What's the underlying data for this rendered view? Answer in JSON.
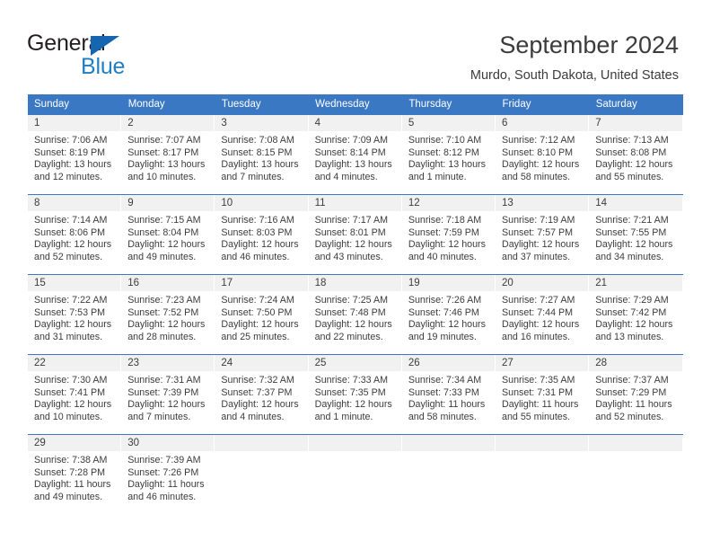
{
  "brand": {
    "name_primary": "General",
    "name_secondary": "Blue",
    "triangle_color": "#1565b0",
    "secondary_color": "#1f7ec4"
  },
  "header": {
    "title": "September 2024",
    "subtitle": "Murdo, South Dakota, United States",
    "accent_color": "#3b78c3",
    "band_color": "#f1f1f1"
  },
  "calendar": {
    "weekday_headers": [
      "Sunday",
      "Monday",
      "Tuesday",
      "Wednesday",
      "Thursday",
      "Friday",
      "Saturday"
    ],
    "weeks": [
      [
        {
          "day": "1",
          "sunrise": "Sunrise: 7:06 AM",
          "sunset": "Sunset: 8:19 PM",
          "daylight_line1": "Daylight: 13 hours",
          "daylight_line2": "and 12 minutes."
        },
        {
          "day": "2",
          "sunrise": "Sunrise: 7:07 AM",
          "sunset": "Sunset: 8:17 PM",
          "daylight_line1": "Daylight: 13 hours",
          "daylight_line2": "and 10 minutes."
        },
        {
          "day": "3",
          "sunrise": "Sunrise: 7:08 AM",
          "sunset": "Sunset: 8:15 PM",
          "daylight_line1": "Daylight: 13 hours",
          "daylight_line2": "and 7 minutes."
        },
        {
          "day": "4",
          "sunrise": "Sunrise: 7:09 AM",
          "sunset": "Sunset: 8:14 PM",
          "daylight_line1": "Daylight: 13 hours",
          "daylight_line2": "and 4 minutes."
        },
        {
          "day": "5",
          "sunrise": "Sunrise: 7:10 AM",
          "sunset": "Sunset: 8:12 PM",
          "daylight_line1": "Daylight: 13 hours",
          "daylight_line2": "and 1 minute."
        },
        {
          "day": "6",
          "sunrise": "Sunrise: 7:12 AM",
          "sunset": "Sunset: 8:10 PM",
          "daylight_line1": "Daylight: 12 hours",
          "daylight_line2": "and 58 minutes."
        },
        {
          "day": "7",
          "sunrise": "Sunrise: 7:13 AM",
          "sunset": "Sunset: 8:08 PM",
          "daylight_line1": "Daylight: 12 hours",
          "daylight_line2": "and 55 minutes."
        }
      ],
      [
        {
          "day": "8",
          "sunrise": "Sunrise: 7:14 AM",
          "sunset": "Sunset: 8:06 PM",
          "daylight_line1": "Daylight: 12 hours",
          "daylight_line2": "and 52 minutes."
        },
        {
          "day": "9",
          "sunrise": "Sunrise: 7:15 AM",
          "sunset": "Sunset: 8:04 PM",
          "daylight_line1": "Daylight: 12 hours",
          "daylight_line2": "and 49 minutes."
        },
        {
          "day": "10",
          "sunrise": "Sunrise: 7:16 AM",
          "sunset": "Sunset: 8:03 PM",
          "daylight_line1": "Daylight: 12 hours",
          "daylight_line2": "and 46 minutes."
        },
        {
          "day": "11",
          "sunrise": "Sunrise: 7:17 AM",
          "sunset": "Sunset: 8:01 PM",
          "daylight_line1": "Daylight: 12 hours",
          "daylight_line2": "and 43 minutes."
        },
        {
          "day": "12",
          "sunrise": "Sunrise: 7:18 AM",
          "sunset": "Sunset: 7:59 PM",
          "daylight_line1": "Daylight: 12 hours",
          "daylight_line2": "and 40 minutes."
        },
        {
          "day": "13",
          "sunrise": "Sunrise: 7:19 AM",
          "sunset": "Sunset: 7:57 PM",
          "daylight_line1": "Daylight: 12 hours",
          "daylight_line2": "and 37 minutes."
        },
        {
          "day": "14",
          "sunrise": "Sunrise: 7:21 AM",
          "sunset": "Sunset: 7:55 PM",
          "daylight_line1": "Daylight: 12 hours",
          "daylight_line2": "and 34 minutes."
        }
      ],
      [
        {
          "day": "15",
          "sunrise": "Sunrise: 7:22 AM",
          "sunset": "Sunset: 7:53 PM",
          "daylight_line1": "Daylight: 12 hours",
          "daylight_line2": "and 31 minutes."
        },
        {
          "day": "16",
          "sunrise": "Sunrise: 7:23 AM",
          "sunset": "Sunset: 7:52 PM",
          "daylight_line1": "Daylight: 12 hours",
          "daylight_line2": "and 28 minutes."
        },
        {
          "day": "17",
          "sunrise": "Sunrise: 7:24 AM",
          "sunset": "Sunset: 7:50 PM",
          "daylight_line1": "Daylight: 12 hours",
          "daylight_line2": "and 25 minutes."
        },
        {
          "day": "18",
          "sunrise": "Sunrise: 7:25 AM",
          "sunset": "Sunset: 7:48 PM",
          "daylight_line1": "Daylight: 12 hours",
          "daylight_line2": "and 22 minutes."
        },
        {
          "day": "19",
          "sunrise": "Sunrise: 7:26 AM",
          "sunset": "Sunset: 7:46 PM",
          "daylight_line1": "Daylight: 12 hours",
          "daylight_line2": "and 19 minutes."
        },
        {
          "day": "20",
          "sunrise": "Sunrise: 7:27 AM",
          "sunset": "Sunset: 7:44 PM",
          "daylight_line1": "Daylight: 12 hours",
          "daylight_line2": "and 16 minutes."
        },
        {
          "day": "21",
          "sunrise": "Sunrise: 7:29 AM",
          "sunset": "Sunset: 7:42 PM",
          "daylight_line1": "Daylight: 12 hours",
          "daylight_line2": "and 13 minutes."
        }
      ],
      [
        {
          "day": "22",
          "sunrise": "Sunrise: 7:30 AM",
          "sunset": "Sunset: 7:41 PM",
          "daylight_line1": "Daylight: 12 hours",
          "daylight_line2": "and 10 minutes."
        },
        {
          "day": "23",
          "sunrise": "Sunrise: 7:31 AM",
          "sunset": "Sunset: 7:39 PM",
          "daylight_line1": "Daylight: 12 hours",
          "daylight_line2": "and 7 minutes."
        },
        {
          "day": "24",
          "sunrise": "Sunrise: 7:32 AM",
          "sunset": "Sunset: 7:37 PM",
          "daylight_line1": "Daylight: 12 hours",
          "daylight_line2": "and 4 minutes."
        },
        {
          "day": "25",
          "sunrise": "Sunrise: 7:33 AM",
          "sunset": "Sunset: 7:35 PM",
          "daylight_line1": "Daylight: 12 hours",
          "daylight_line2": "and 1 minute."
        },
        {
          "day": "26",
          "sunrise": "Sunrise: 7:34 AM",
          "sunset": "Sunset: 7:33 PM",
          "daylight_line1": "Daylight: 11 hours",
          "daylight_line2": "and 58 minutes."
        },
        {
          "day": "27",
          "sunrise": "Sunrise: 7:35 AM",
          "sunset": "Sunset: 7:31 PM",
          "daylight_line1": "Daylight: 11 hours",
          "daylight_line2": "and 55 minutes."
        },
        {
          "day": "28",
          "sunrise": "Sunrise: 7:37 AM",
          "sunset": "Sunset: 7:29 PM",
          "daylight_line1": "Daylight: 11 hours",
          "daylight_line2": "and 52 minutes."
        }
      ],
      [
        {
          "day": "29",
          "sunrise": "Sunrise: 7:38 AM",
          "sunset": "Sunset: 7:28 PM",
          "daylight_line1": "Daylight: 11 hours",
          "daylight_line2": "and 49 minutes."
        },
        {
          "day": "30",
          "sunrise": "Sunrise: 7:39 AM",
          "sunset": "Sunset: 7:26 PM",
          "daylight_line1": "Daylight: 11 hours",
          "daylight_line2": "and 46 minutes."
        },
        {
          "day": "",
          "sunrise": "",
          "sunset": "",
          "daylight_line1": "",
          "daylight_line2": ""
        },
        {
          "day": "",
          "sunrise": "",
          "sunset": "",
          "daylight_line1": "",
          "daylight_line2": ""
        },
        {
          "day": "",
          "sunrise": "",
          "sunset": "",
          "daylight_line1": "",
          "daylight_line2": ""
        },
        {
          "day": "",
          "sunrise": "",
          "sunset": "",
          "daylight_line1": "",
          "daylight_line2": ""
        },
        {
          "day": "",
          "sunrise": "",
          "sunset": "",
          "daylight_line1": "",
          "daylight_line2": ""
        }
      ]
    ]
  }
}
